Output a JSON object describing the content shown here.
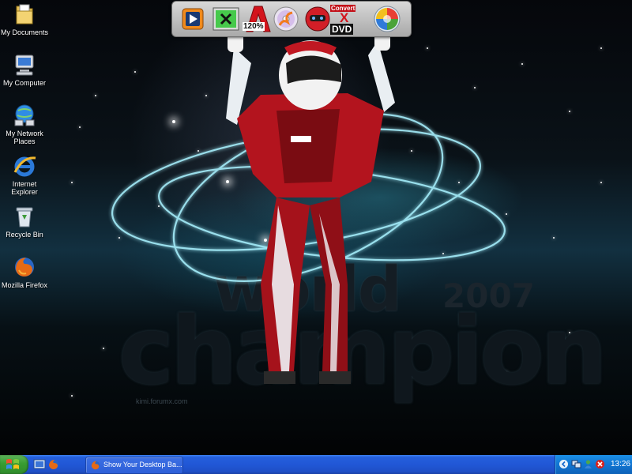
{
  "desktop": {
    "icons": [
      {
        "label": "My Documents",
        "icon": "folder-documents-icon"
      },
      {
        "label": "My Computer",
        "icon": "computer-icon"
      },
      {
        "label": "My Network Places",
        "icon": "network-icon"
      },
      {
        "label": "Internet Explorer",
        "icon": "internet-explorer-icon"
      },
      {
        "label": "Recycle Bin",
        "icon": "recycle-bin-icon"
      },
      {
        "label": "Mozilla Firefox",
        "icon": "firefox-icon"
      }
    ]
  },
  "launcher": {
    "items": [
      {
        "name": "media-player-icon"
      },
      {
        "name": "xbox-app-icon"
      },
      {
        "name": "zoom-tool-icon",
        "text": "120%"
      },
      {
        "name": "cd-burner-icon"
      },
      {
        "name": "racing-helmet-icon"
      },
      {
        "name": "convert-dvd-icon",
        "text_top": "Convert",
        "text_mid": "X",
        "text_bottom": "DVD"
      },
      {
        "name": "windows-orb-icon"
      }
    ]
  },
  "wallpaper": {
    "world": "world",
    "year": "2007",
    "champion": "champion",
    "credit": "kimi.forumx.com"
  },
  "taskbar": {
    "start": "start-button",
    "task_label": "Show Your Desktop Ba...",
    "clock": "13:26"
  },
  "colors": {
    "taskbar_blue": "#245edb",
    "start_green": "#389c32",
    "tray_blue": "#1175d2"
  }
}
